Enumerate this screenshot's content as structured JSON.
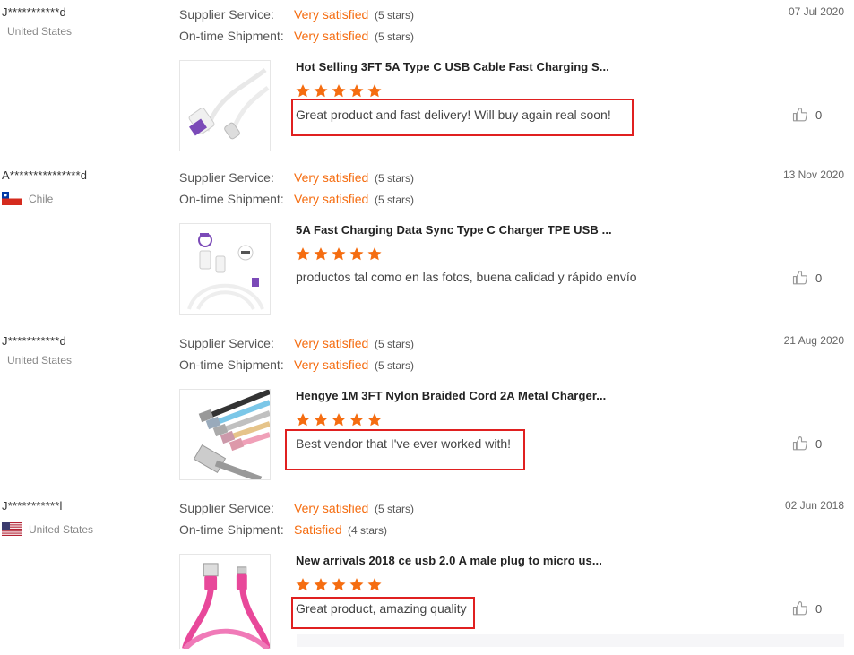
{
  "reviews": [
    {
      "user": "J***********d",
      "country": "United States",
      "date": "07 Jul 2020",
      "supplier_label": "Supplier Service:",
      "supplier_value": "Very satisfied",
      "supplier_stars": "(5 stars)",
      "shipment_label": "On-time Shipment:",
      "shipment_value": "Very satisfied",
      "shipment_stars": "(5 stars)",
      "product_title": "Hot Selling 3FT 5A Type C USB Cable Fast Charging S...",
      "rating": 5,
      "comment": "Great product and fast delivery! Will buy again real soon!",
      "likes": "0"
    },
    {
      "user": "A***************d",
      "country": "Chile",
      "date": "13 Nov 2020",
      "supplier_label": "Supplier Service:",
      "supplier_value": "Very satisfied",
      "supplier_stars": "(5 stars)",
      "shipment_label": "On-time Shipment:",
      "shipment_value": "Very satisfied",
      "shipment_stars": "(5 stars)",
      "product_title": "5A Fast Charging Data Sync Type C Charger TPE USB ...",
      "rating": 5,
      "comment": "productos tal como en las fotos, buena calidad y rápido envío",
      "likes": "0"
    },
    {
      "user": "J***********d",
      "country": "United States",
      "date": "21 Aug 2020",
      "supplier_label": "Supplier Service:",
      "supplier_value": "Very satisfied",
      "supplier_stars": "(5 stars)",
      "shipment_label": "On-time Shipment:",
      "shipment_value": "Very satisfied",
      "shipment_stars": "(5 stars)",
      "product_title": "Hengye 1M 3FT Nylon Braided Cord 2A Metal Charger...",
      "rating": 5,
      "comment": "Best vendor that I've ever worked with!",
      "likes": "0"
    },
    {
      "user": "J***********l",
      "country": "United States",
      "date": "02 Jun 2018",
      "supplier_label": "Supplier Service:",
      "supplier_value": "Very satisfied",
      "supplier_stars": "(5 stars)",
      "shipment_label": "On-time Shipment:",
      "shipment_value": "Satisfied",
      "shipment_stars": "(4 stars)",
      "product_title": "New arrivals 2018 ce usb 2.0 A male plug to micro us...",
      "rating": 5,
      "comment": "Great product, amazing quality",
      "likes": "0"
    }
  ],
  "icons": {
    "like": "thumbs-up-icon",
    "star": "star-icon",
    "flag_chile": "chile-flag-icon",
    "flag_us": "us-flag-icon"
  },
  "colors": {
    "accent": "#f56d11",
    "star": "#f56d11",
    "highlight": "#e02020"
  }
}
